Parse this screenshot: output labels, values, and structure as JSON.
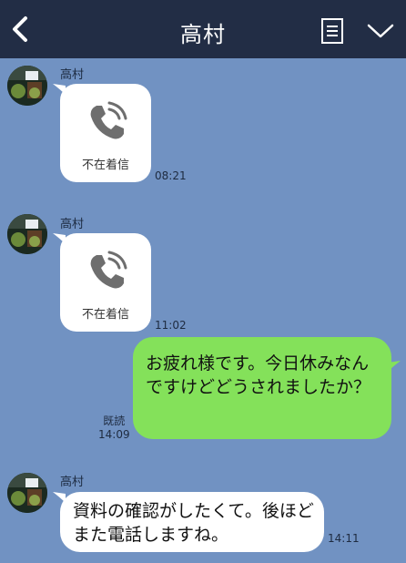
{
  "header": {
    "title": "高村"
  },
  "messages": [
    {
      "type": "call",
      "sender": "高村",
      "label": "不在着信",
      "time": "08:21"
    },
    {
      "type": "call",
      "sender": "高村",
      "label": "不在着信",
      "time": "11:02"
    },
    {
      "type": "text",
      "direction": "outgoing",
      "read": "既読",
      "time": "14:09",
      "text": "お疲れ様です。今日休みなんですけどどうされましたか？"
    },
    {
      "type": "text",
      "direction": "incoming",
      "sender": "高村",
      "time": "14:11",
      "text": "資料の確認がしたくて。後ほどまた電話しますね。"
    }
  ],
  "colors": {
    "header_bg": "#222d45",
    "chat_bg": "#7192c2",
    "outgoing_bubble": "#84e15a",
    "incoming_bubble": "#ffffff"
  }
}
